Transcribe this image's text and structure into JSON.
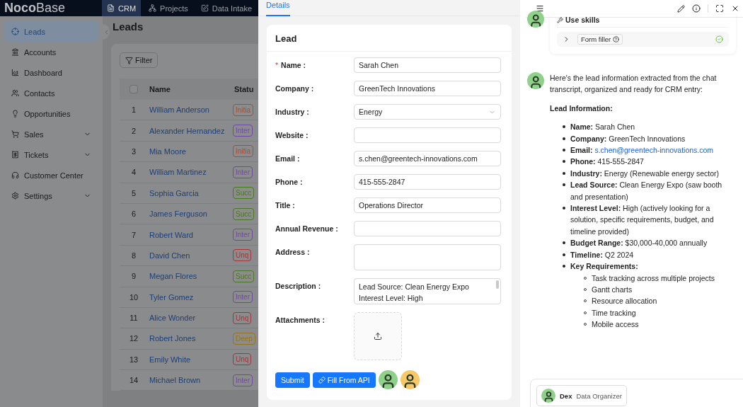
{
  "top_bar": {
    "logo": "**Noco**Base",
    "menu": [
      {
        "label": "CRM",
        "selected": true
      },
      {
        "label": "Projects",
        "selected": false
      },
      {
        "label": "Data Intake",
        "selected": false
      }
    ]
  },
  "sidebar": {
    "items": [
      {
        "label": "Leads",
        "selected": true,
        "expandable": false
      },
      {
        "label": "Accounts",
        "selected": false,
        "expandable": false
      },
      {
        "label": "Dashboard",
        "selected": false,
        "expandable": false
      },
      {
        "label": "Contacts",
        "selected": false,
        "expandable": false
      },
      {
        "label": "Opportunities",
        "selected": false,
        "expandable": false
      },
      {
        "label": "Sales",
        "selected": false,
        "expandable": true
      },
      {
        "label": "Tickets",
        "selected": false,
        "expandable": true
      },
      {
        "label": "Customer Center",
        "selected": false,
        "expandable": false
      },
      {
        "label": "Settings",
        "selected": false,
        "expandable": true
      }
    ]
  },
  "page": {
    "title": "Leads",
    "filter_button": "Filter",
    "table": {
      "select_all_checked": false,
      "columns": [
        "Name",
        "Statu"
      ],
      "rows": [
        {
          "index": "1",
          "name": "William Anderson",
          "status": "Initia",
          "color": "#a0503a"
        },
        {
          "index": "2",
          "name": "Alexander Hernandez",
          "status": "Inter",
          "color": "#6c4c9e"
        },
        {
          "index": "3",
          "name": "Mia Moore",
          "status": "Initia",
          "color": "#a0503a"
        },
        {
          "index": "4",
          "name": "William Martinez",
          "status": "Inter",
          "color": "#6c4c9e"
        },
        {
          "index": "5",
          "name": "Sophia Garcia",
          "status": "Succ",
          "color": "#467a1e"
        },
        {
          "index": "6",
          "name": "James Ferguson",
          "status": "Succ",
          "color": "#467a1e"
        },
        {
          "index": "7",
          "name": "Robert Ward",
          "status": "Inter",
          "color": "#6c4c9e"
        },
        {
          "index": "8",
          "name": "David Chen",
          "status": "Unq",
          "color": "#a3343a"
        },
        {
          "index": "9",
          "name": "Megan Flores",
          "status": "Succ",
          "color": "#467a1e"
        },
        {
          "index": "10",
          "name": "Tyler Gomez",
          "status": "Inter",
          "color": "#6c4c9e"
        },
        {
          "index": "11",
          "name": "Alice Wonder",
          "status": "Unq",
          "color": "#a3343a"
        },
        {
          "index": "12",
          "name": "Robert Jones",
          "status": "Deep",
          "color": "#9a7312"
        },
        {
          "index": "13",
          "name": "Emily White",
          "status": "Unq",
          "color": "#a3343a"
        },
        {
          "index": "14",
          "name": "Michael Brown",
          "status": "Inter",
          "color": "#6c4c9e"
        }
      ]
    }
  },
  "drawer": {
    "tabs": [
      {
        "label": "Details",
        "selected": true
      }
    ],
    "card_title": "Lead",
    "required_marker": "*",
    "fields": [
      {
        "label": "Name :",
        "kind": "text",
        "required": true,
        "value": "Sarah Chen"
      },
      {
        "label": "Company :",
        "kind": "text",
        "required": false,
        "value": "GreenTech Innovations"
      },
      {
        "label": "Industry :",
        "kind": "select",
        "required": false,
        "value": "Energy"
      },
      {
        "label": "Website :",
        "kind": "text",
        "required": false
      },
      {
        "label": "Email :",
        "kind": "text",
        "required": false,
        "value": "s.chen@greentech-innovations.com"
      },
      {
        "label": "Phone :",
        "kind": "text",
        "required": false,
        "value": "415-555-2847"
      },
      {
        "label": "Title :",
        "kind": "text",
        "required": false,
        "value": "Operations Director"
      },
      {
        "label": "Annual Revenue :",
        "kind": "text",
        "required": false
      },
      {
        "label": "Address :",
        "kind": "textarea",
        "required": false
      },
      {
        "label": "Description :",
        "kind": "textarea",
        "required": false,
        "lines": [
          "Lead Source: Clean Energy Expo",
          "Interest Level: High"
        ]
      },
      {
        "label": "Attachments :",
        "kind": "upload",
        "required": false
      }
    ],
    "buttons": [
      {
        "label": "Submit",
        "kind": "primary"
      },
      {
        "label": "Fill From API",
        "kind": "link"
      }
    ],
    "avatars": [
      {
        "color": "#8fd18a"
      },
      {
        "color": "#f6c86a"
      }
    ]
  },
  "chat": {
    "messages": [
      {
        "kind": "skills",
        "title": "Use skills",
        "skills": [
          {
            "label": "Form filler",
            "done": true
          }
        ]
      },
      {
        "kind": "text",
        "intro": "Here's the lead information extracted from the chat transcript, organized and ready for CRM entry:",
        "heading": "Lead Information:",
        "items": [
          {
            "kind": "text",
            "text": "**Name:** Sarah Chen"
          },
          {
            "kind": "text",
            "text": "**Company:** GreenTech Innovations"
          },
          {
            "kind": "link",
            "label": "Email:",
            "value": "s.chen@greentech-innovations.com"
          },
          {
            "kind": "text",
            "text": "**Phone:** 415-555-2847"
          },
          {
            "kind": "text",
            "text": "**Industry:** Energy (Renewable energy sector)"
          },
          {
            "kind": "text",
            "text": "**Lead Source:** Clean Energy Expo (saw booth and presentation)"
          },
          {
            "kind": "text",
            "text": "**Interest Level:** High (actively looking for a solution, specific requirements, budget, and timeline provided)"
          },
          {
            "kind": "text",
            "text": "**Budget Range:** $30,000-40,000 annually"
          },
          {
            "kind": "text",
            "text": "**Timeline:** Q2 2024"
          },
          {
            "kind": "group",
            "label": "Key Requirements:",
            "children": [
              "Task tracking across multiple projects",
              "Gantt charts",
              "Resource allocation",
              "Time tracking",
              "Mobile access"
            ]
          }
        ]
      }
    ],
    "agent": {
      "name": "Dex",
      "role": "Data Organizer"
    }
  }
}
